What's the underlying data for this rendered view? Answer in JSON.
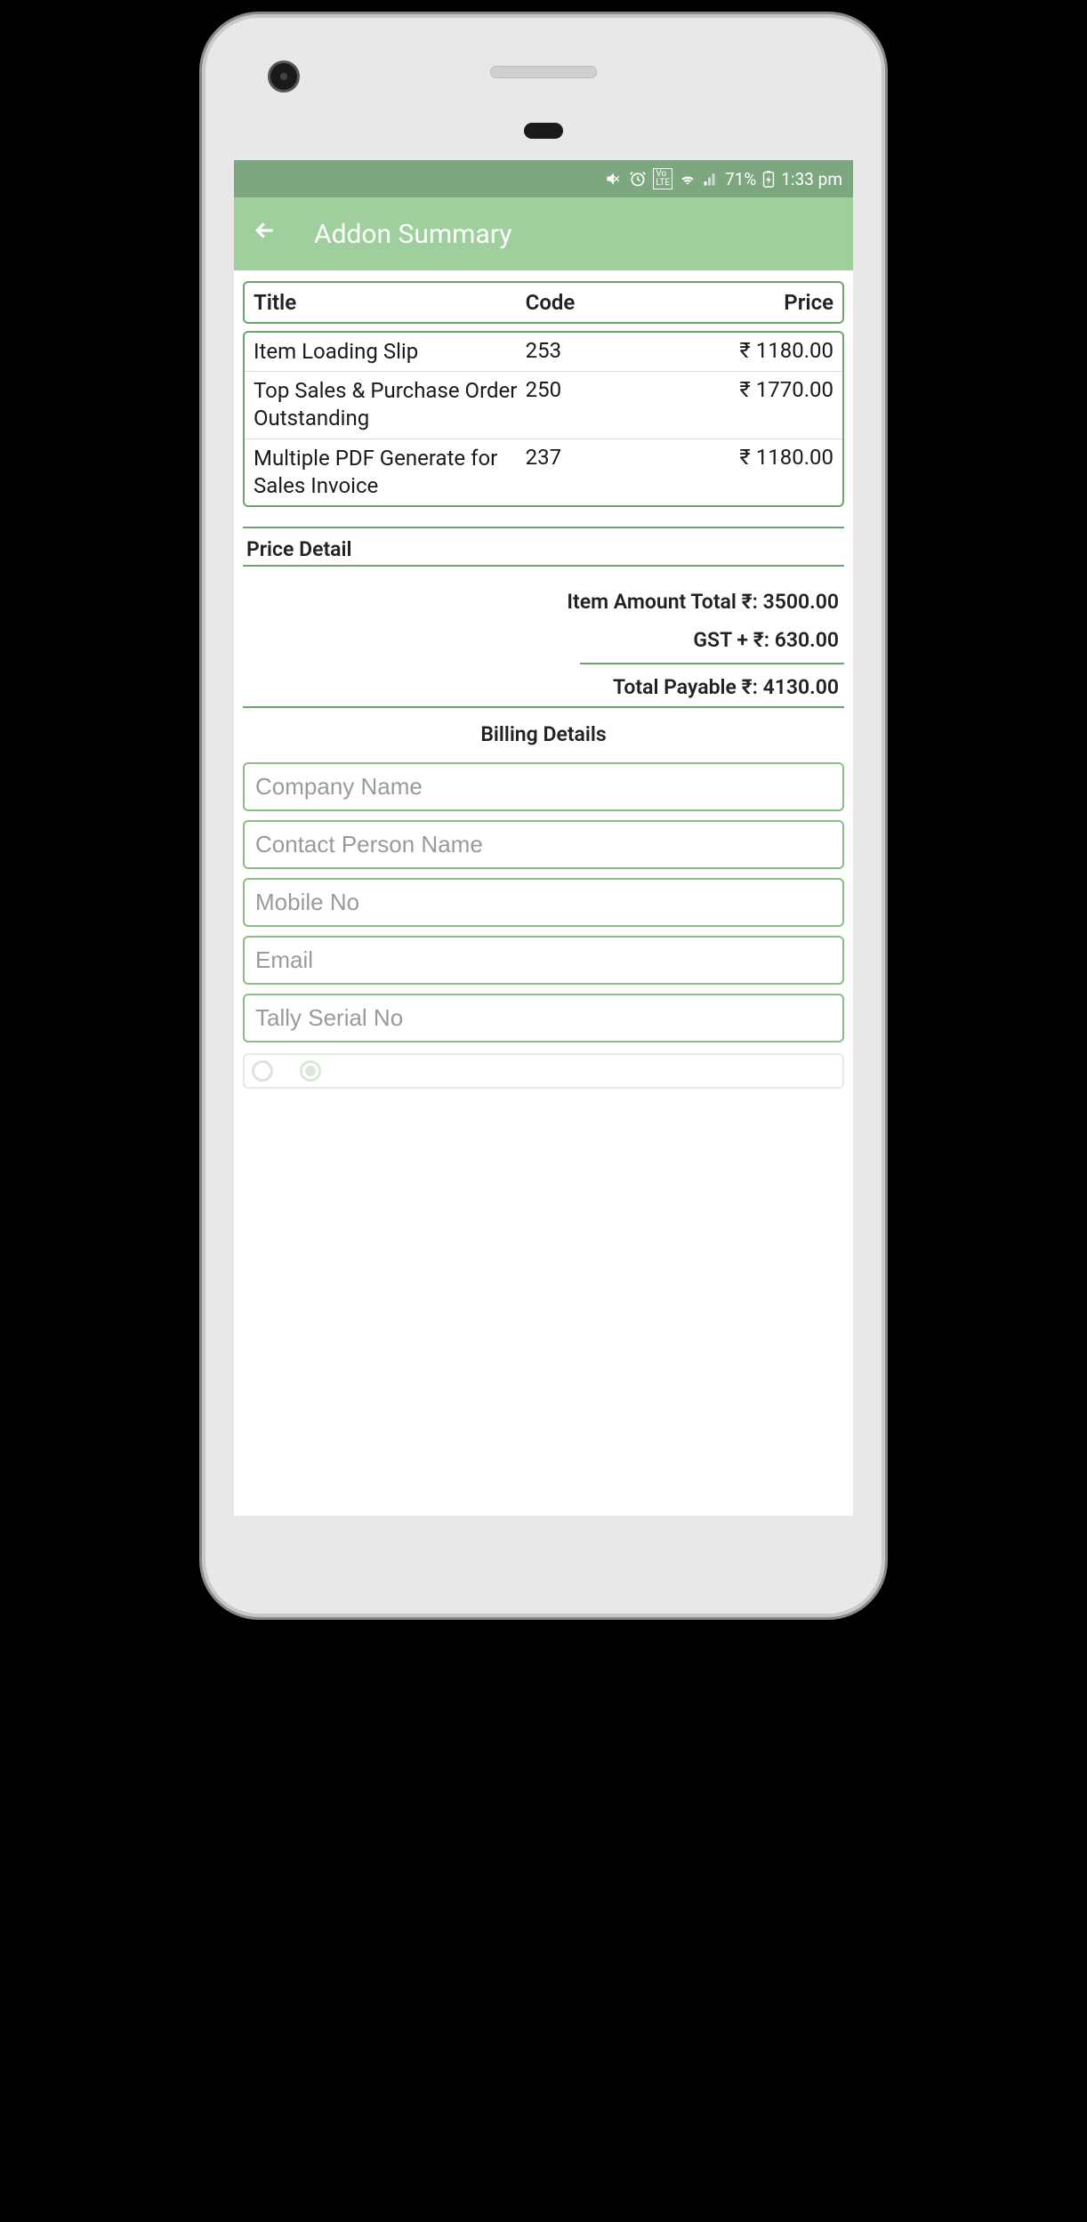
{
  "status": {
    "battery": "71%",
    "time": "1:33 pm"
  },
  "header": {
    "title": "Addon Summary"
  },
  "table": {
    "headers": {
      "title": "Title",
      "code": "Code",
      "price": "Price"
    },
    "rows": [
      {
        "title": "Item Loading Slip",
        "code": "253",
        "price": "₹ 1180.00"
      },
      {
        "title": "Top Sales & Purchase Order Outstanding",
        "code": "250",
        "price": "₹ 1770.00"
      },
      {
        "title": "Multiple PDF Generate for Sales Invoice",
        "code": "237",
        "price": "₹ 1180.00"
      }
    ]
  },
  "price_detail": {
    "heading": "Price Detail",
    "item_total": "Item Amount Total ₹: 3500.00",
    "gst": "GST + ₹: 630.00",
    "total_payable": "Total Payable ₹: 4130.00"
  },
  "billing": {
    "heading": "Billing Details",
    "fields": {
      "company": "Company Name",
      "contact": "Contact Person Name",
      "mobile": "Mobile No",
      "email": "Email",
      "tally": "Tally Serial No"
    }
  }
}
